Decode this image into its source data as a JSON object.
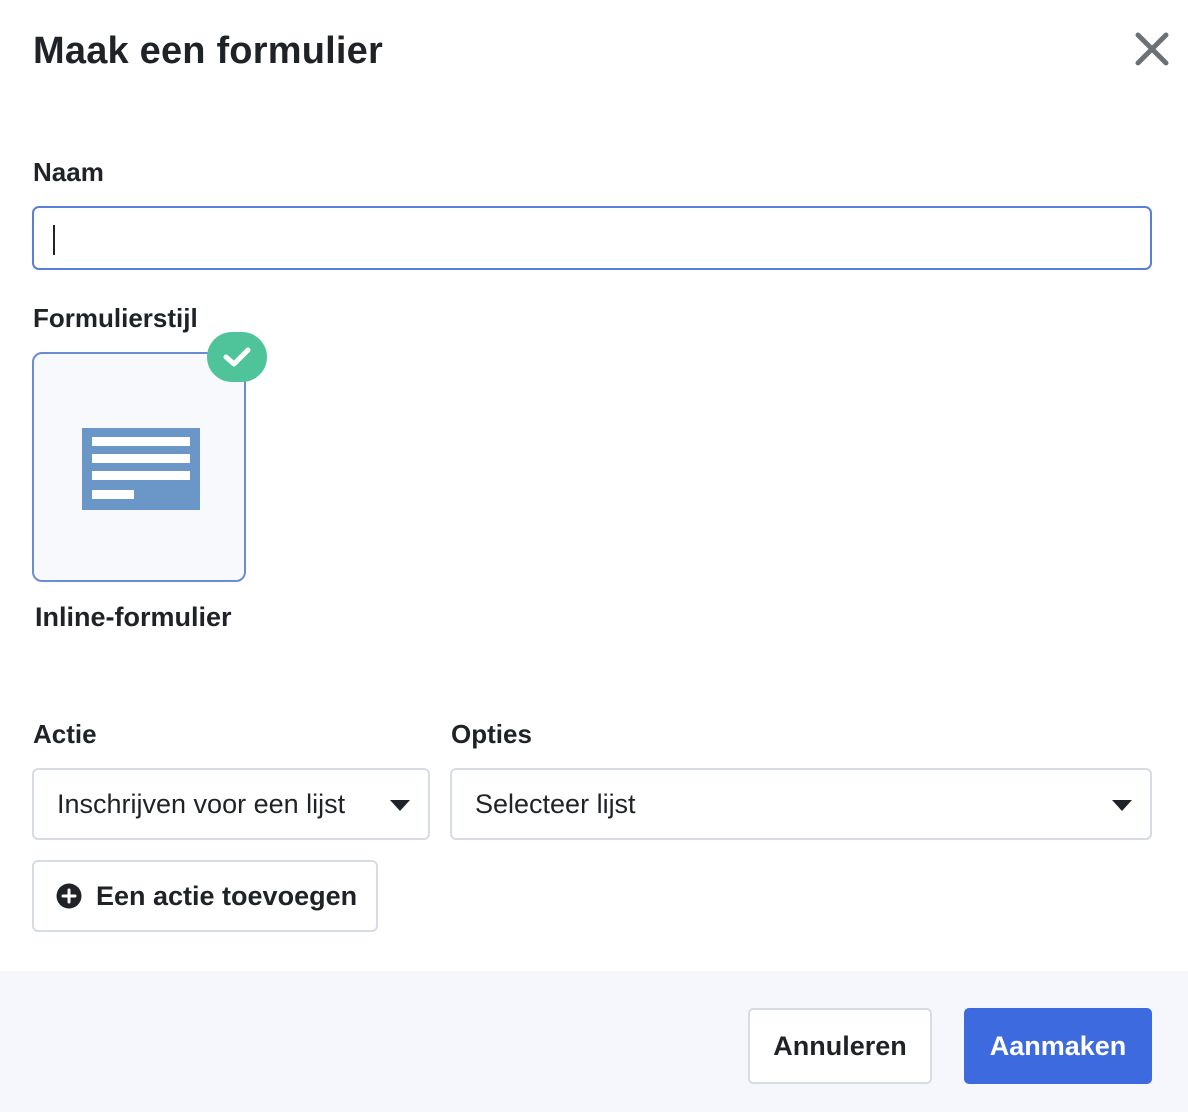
{
  "dialog": {
    "title": "Maak een formulier",
    "close_icon": "close-icon"
  },
  "name_field": {
    "label": "Naam",
    "value": "",
    "placeholder": ""
  },
  "form_style": {
    "label": "Formulierstijl",
    "selected": true,
    "option_name": "Inline-formulier",
    "option_icon": "inline-form-icon",
    "check_icon": "check-icon"
  },
  "action": {
    "label": "Actie",
    "selected": "Inschrijven voor een lijst"
  },
  "options": {
    "label": "Opties",
    "selected": "Selecteer lijst"
  },
  "add_action": {
    "label": "Een actie toevoegen",
    "icon": "plus-circle-icon"
  },
  "footer": {
    "cancel_label": "Annuleren",
    "submit_label": "Aanmaken"
  },
  "colors": {
    "accent": "#3e6ae0",
    "focus_border": "#5a7fd6",
    "check": "#4fc49a",
    "form_icon": "#6b96c8",
    "footer_bg": "#f5f7fd"
  }
}
